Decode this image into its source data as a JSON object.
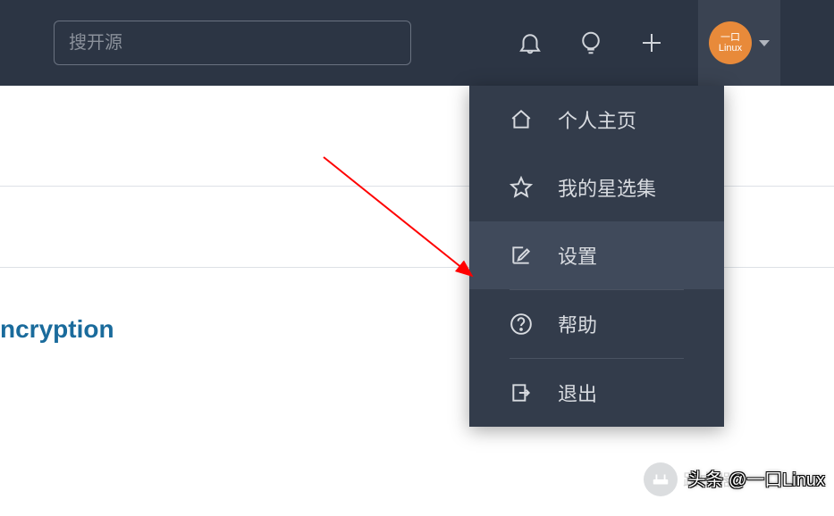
{
  "topbar": {
    "search_placeholder": "搜开源",
    "avatar_text_line1": "一口",
    "avatar_text_line2": "Linux"
  },
  "dropdown": {
    "items": [
      {
        "label": "个人主页",
        "icon": "home-icon"
      },
      {
        "label": "我的星选集",
        "icon": "star-icon"
      },
      {
        "label": "设置",
        "icon": "edit-icon",
        "active": true
      },
      {
        "label": "帮助",
        "icon": "help-icon"
      },
      {
        "label": "退出",
        "icon": "logout-icon"
      }
    ]
  },
  "content": {
    "partial_link_text": "ncryption"
  },
  "watermark": {
    "attribution": "头条 @一口Linux",
    "badge_text": "路由器"
  }
}
